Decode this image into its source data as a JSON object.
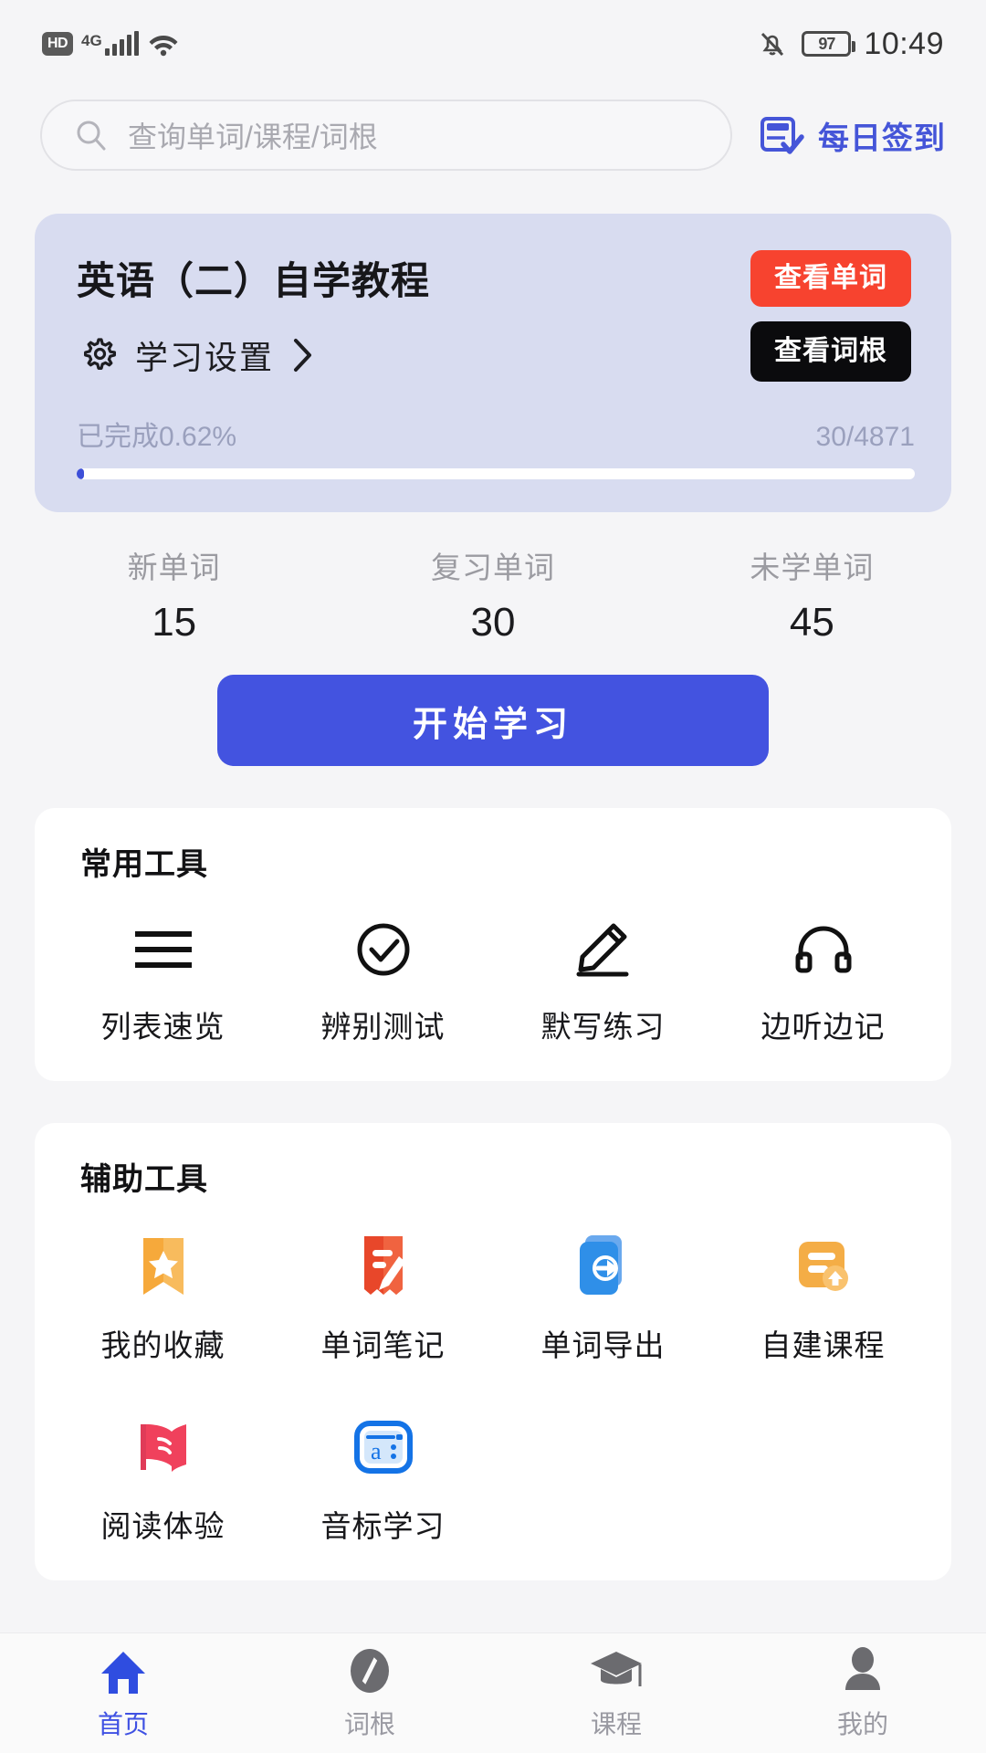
{
  "status_bar": {
    "hd_badge": "HD",
    "network": "4G",
    "signal_icon": "signal-bars-icon",
    "wifi_icon": "wifi-icon",
    "mute_icon": "bell-muted-icon",
    "battery_level": "97",
    "time": "10:49"
  },
  "search": {
    "icon": "search-icon",
    "placeholder": "查询单词/课程/词根",
    "value": ""
  },
  "checkin": {
    "icon": "calendar-check-icon",
    "label": "每日签到",
    "color": "#4555d8"
  },
  "course_card": {
    "title": "英语（二）自学教程",
    "settings_icon": "gear-icon",
    "settings_label": "学习设置",
    "settings_chevron": "chevron-right-icon",
    "view_words_button": "查看单词",
    "view_roots_button": "查看词根",
    "progress_label": "已完成0.62%",
    "progress_count": "30/4871",
    "progress_percent": 0.62,
    "card_bg": "#d8dcf0",
    "red_button_color": "#f7432f",
    "black_button_color": "#0b0b0d"
  },
  "stats": [
    {
      "label": "新单词",
      "value": "15"
    },
    {
      "label": "复习单词",
      "value": "30"
    },
    {
      "label": "未学单词",
      "value": "45"
    }
  ],
  "start_button": {
    "label": "开始学习",
    "color": "#4353e0"
  },
  "common_tools": {
    "title": "常用工具",
    "items": [
      {
        "label": "列表速览",
        "icon": "list-lines-icon"
      },
      {
        "label": "辨别测试",
        "icon": "check-circle-icon"
      },
      {
        "label": "默写练习",
        "icon": "pencil-icon"
      },
      {
        "label": "边听边记",
        "icon": "headphones-icon"
      }
    ]
  },
  "auxiliary_tools": {
    "title": "辅助工具",
    "items": [
      {
        "label": "我的收藏",
        "icon": "bookmark-star-icon",
        "color": "#f6a93b"
      },
      {
        "label": "单词笔记",
        "icon": "note-pencil-icon",
        "color": "#e8472a"
      },
      {
        "label": "单词导出",
        "icon": "export-cards-icon",
        "color": "#2f8fe8"
      },
      {
        "label": "自建课程",
        "icon": "course-upload-icon",
        "color": "#f4ad46"
      },
      {
        "label": "阅读体验",
        "icon": "open-book-icon",
        "color": "#f0415c"
      },
      {
        "label": "音标学习",
        "icon": "phonetic-a-icon",
        "color": "#1473e6"
      }
    ]
  },
  "bottom_nav": {
    "active_index": 0,
    "active_color": "#3f51e3",
    "items": [
      {
        "label": "首页",
        "icon": "home-icon"
      },
      {
        "label": "词根",
        "icon": "compass-icon"
      },
      {
        "label": "课程",
        "icon": "graduation-cap-icon"
      },
      {
        "label": "我的",
        "icon": "person-icon"
      }
    ]
  }
}
